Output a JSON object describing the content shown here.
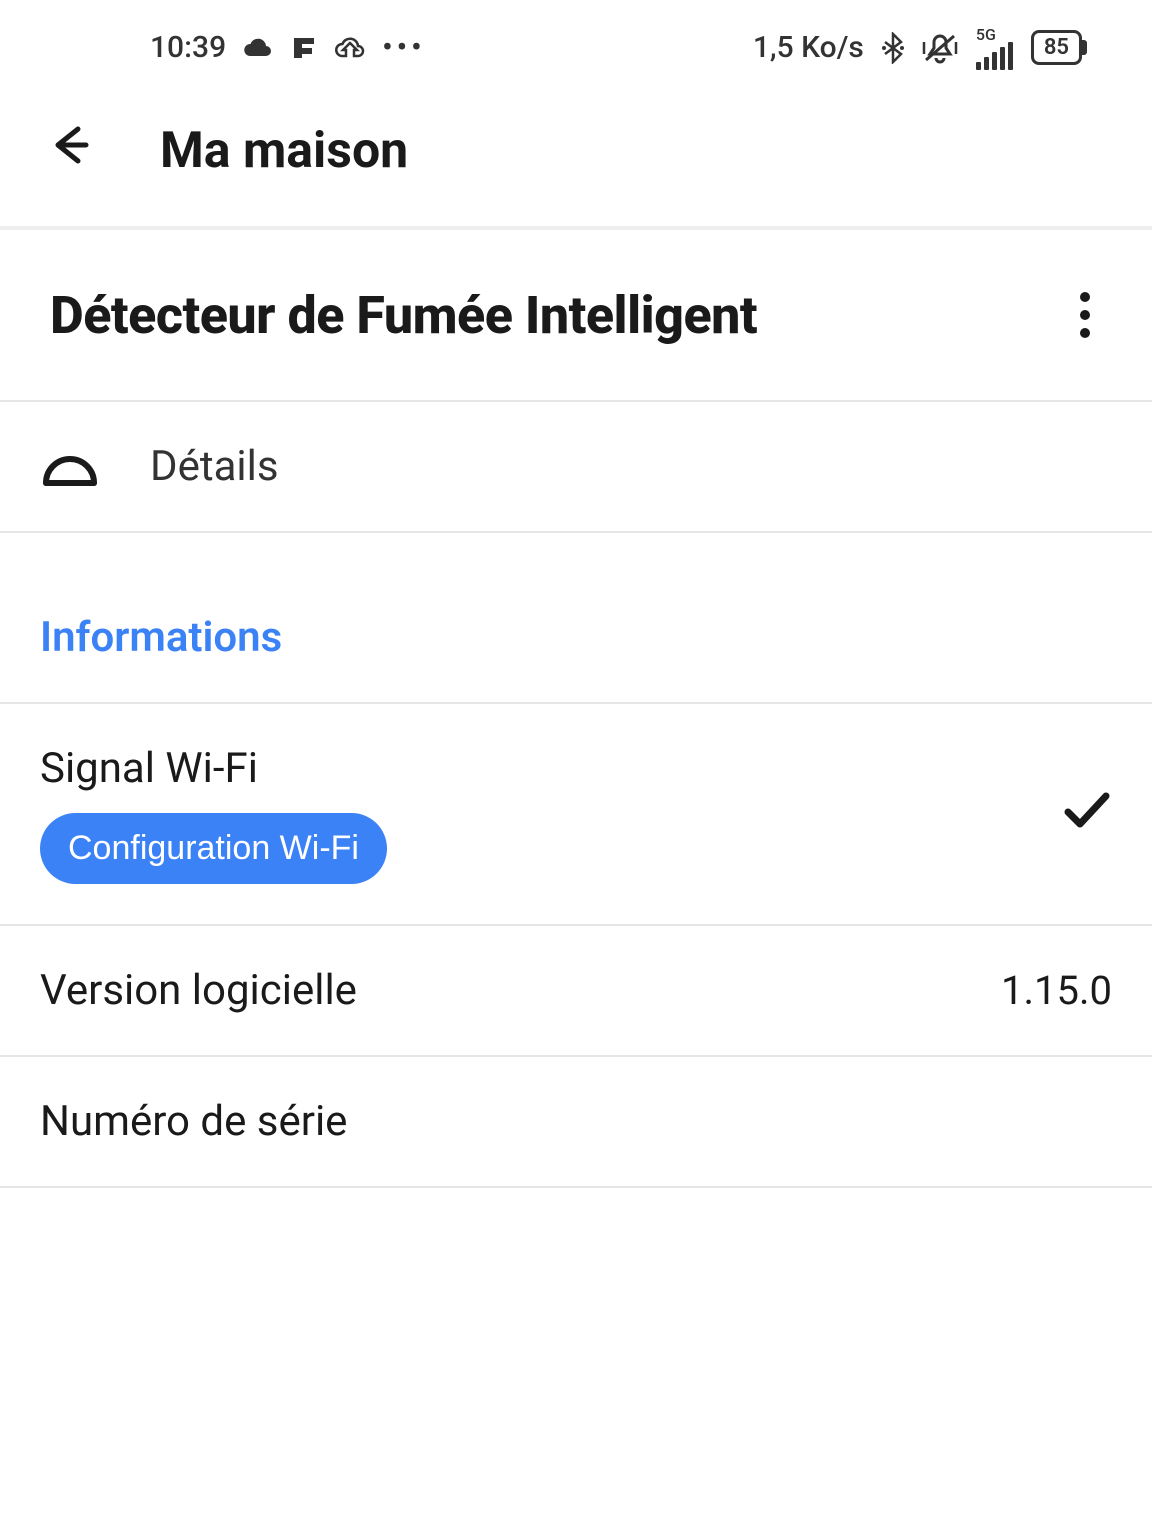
{
  "statusBar": {
    "time": "10:39",
    "dataRate": "1,5 Ko/s",
    "networkLabel": "5G",
    "batteryLevel": "85",
    "ellipsis": "•••"
  },
  "nav": {
    "title": "Ma maison"
  },
  "device": {
    "title": "Détecteur de Fumée Intelligent"
  },
  "tab": {
    "label": "Détails"
  },
  "section": {
    "title": "Informations"
  },
  "rows": {
    "wifi": {
      "label": "Signal Wi-Fi",
      "configButton": "Configuration Wi-Fi"
    },
    "software": {
      "label": "Version logicielle",
      "value": "1.15.0"
    },
    "serial": {
      "label": "Numéro de série",
      "value": ""
    }
  }
}
